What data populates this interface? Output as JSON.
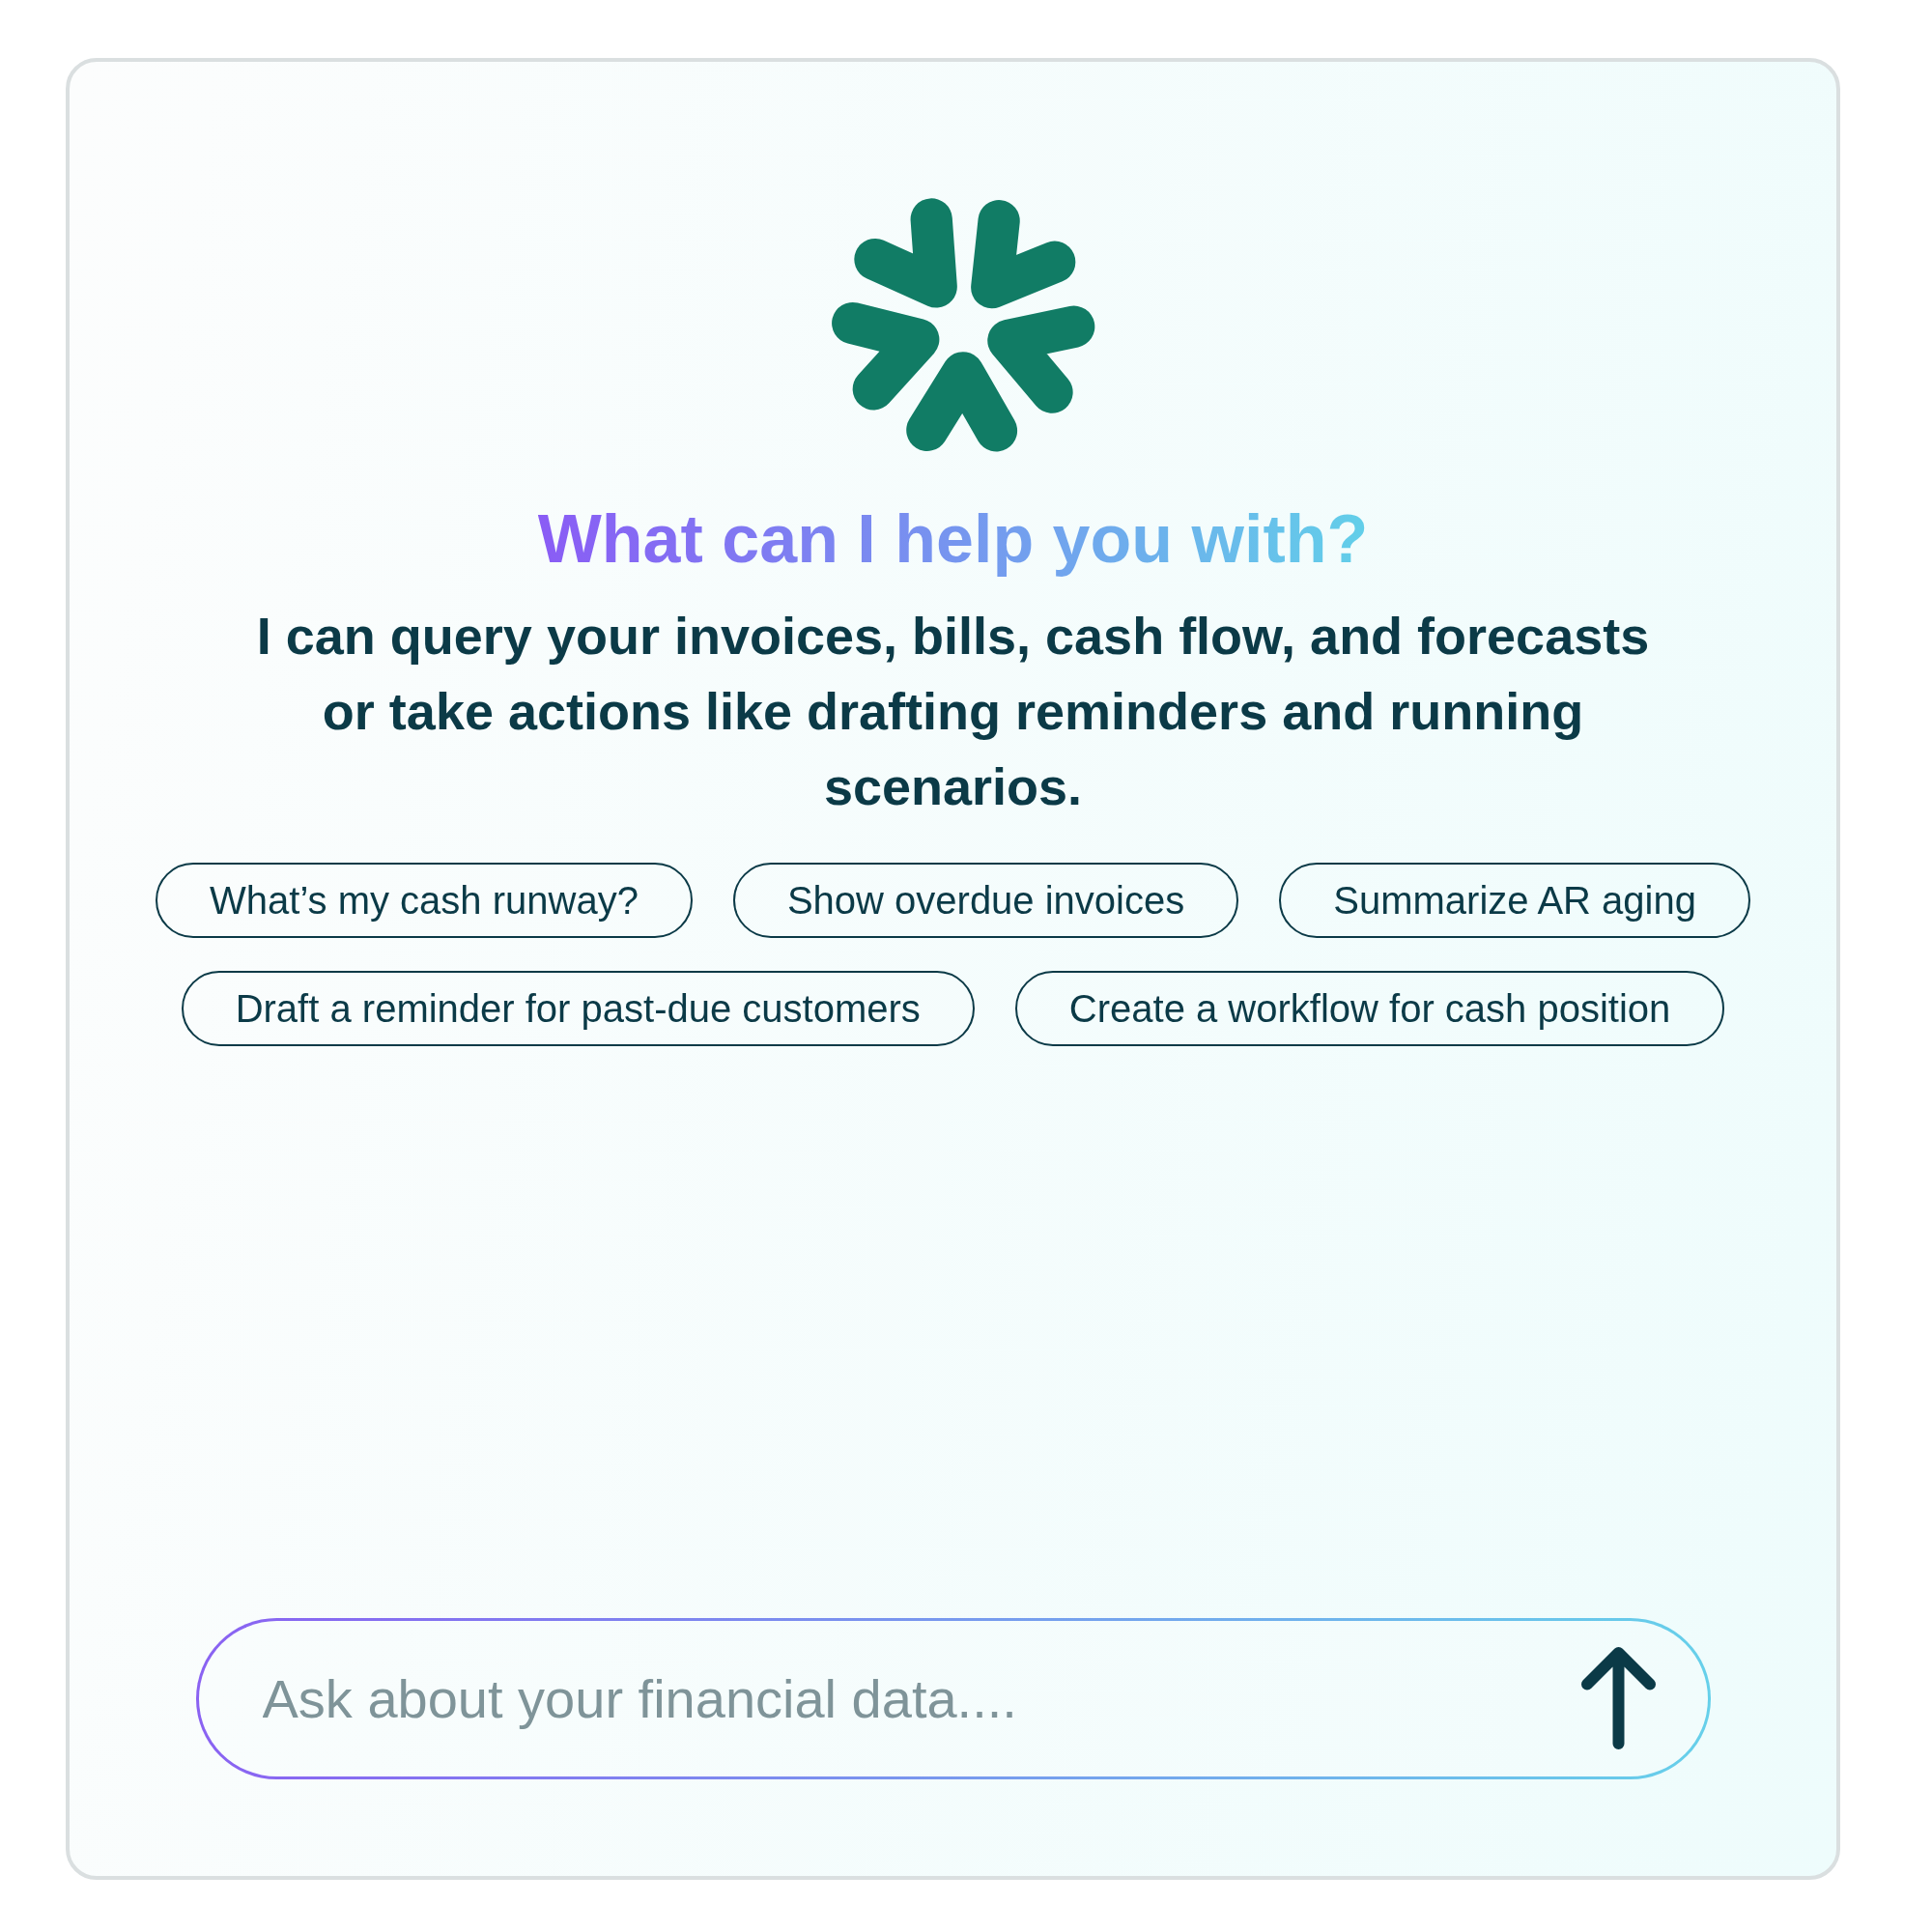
{
  "heading": "What can I help you with?",
  "subtitle": "I can query your invoices, bills, cash flow, and forecasts or take actions like drafting reminders and running scenarios.",
  "suggestions": [
    "What’s my cash runway?",
    "Show overdue invoices",
    "Summarize AR aging",
    "Draft a reminder for past-due customers",
    "Create a workflow for cash position"
  ],
  "composer": {
    "placeholder": "Ask about your financial data...."
  }
}
